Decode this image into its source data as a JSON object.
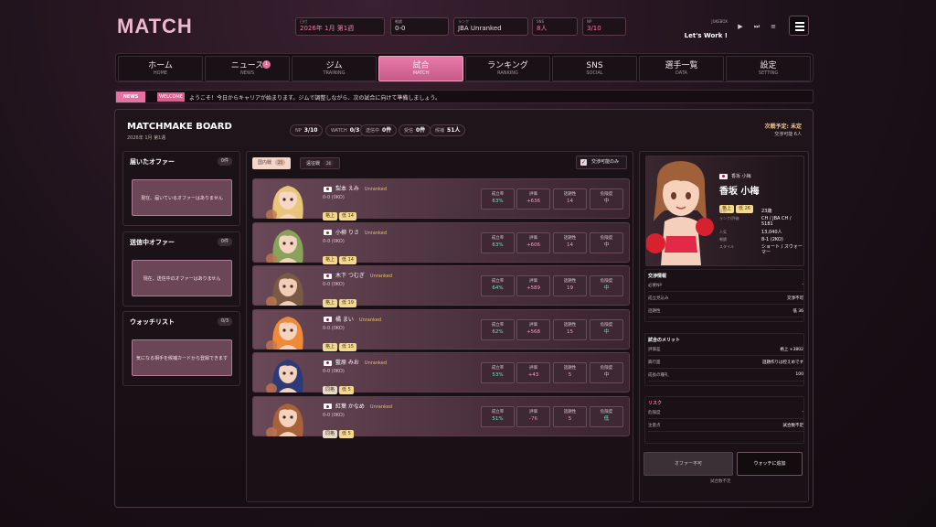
{
  "app": {
    "logo": "MATCH"
  },
  "stats": [
    {
      "label": "日付",
      "value": "2026年 1月 第1週",
      "pink": true
    },
    {
      "label": "戦績",
      "value": "0-0",
      "pink": false
    },
    {
      "label": "ランク",
      "value": "JBA Unranked",
      "pink": false
    },
    {
      "label": "SNS",
      "value": "8人",
      "pink": true
    },
    {
      "label": "NP",
      "value": "3/10",
      "pink": true
    }
  ],
  "jukebox": {
    "label": "JUKEBOX",
    "track": "Let's Work !"
  },
  "nav": [
    {
      "label": "ホーム",
      "sub": "HOME"
    },
    {
      "label": "ニュース",
      "sub": "NEWS",
      "badge": "1"
    },
    {
      "label": "ジム",
      "sub": "TRAINING"
    },
    {
      "label": "試合",
      "sub": "MATCH",
      "active": true
    },
    {
      "label": "ランキング",
      "sub": "RANKING"
    },
    {
      "label": "SNS",
      "sub": "SOCIAL"
    },
    {
      "label": "選手一覧",
      "sub": "DATA"
    },
    {
      "label": "設定",
      "sub": "SETTING"
    }
  ],
  "news": {
    "tag": "NEWS",
    "subtag": "WELCOME",
    "text": "ようこそ！今日からキャリアが始まります。ジムで調整しながら、次の試合に向けて準備しましょう。"
  },
  "board": {
    "title": "MATCHMAKE BOARD",
    "date": "2026年 1月 第1週",
    "chips": [
      {
        "label": "NP",
        "value": "3/10"
      },
      {
        "label": "WATCH",
        "value": "0/3"
      },
      {
        "label": "送信中",
        "value": "0件"
      },
      {
        "label": "受信",
        "value": "0件"
      },
      {
        "label": "候補",
        "value": "51人"
      }
    ],
    "next_match": "次戦予定: 未定",
    "negotiable": "交渉可能 6人"
  },
  "left": [
    {
      "title": "届いたオファー",
      "count": "0件",
      "empty": "現在、届いているオファーはありません"
    },
    {
      "title": "送信中オファー",
      "count": "0件",
      "empty": "現在、送信中のオファーはありません"
    },
    {
      "title": "ウォッチリスト",
      "count": "0/3",
      "empty": "気になる相手を候補カードから登録できます"
    }
  ],
  "filters": {
    "domestic": "国内戦",
    "domestic_count": "25",
    "overseas": "遠征戦",
    "overseas_count": "26",
    "only_negotiable": "交渉可能のみ"
  },
  "stat_labels": {
    "success": "成立率",
    "rating": "評価",
    "topic": "話題性",
    "danger": "危険度"
  },
  "candidates": [
    {
      "name": "梨本 えみ",
      "rank": "Unranked",
      "record": "0-0 (0KO)",
      "tag1": "格上",
      "tag2": "低 14",
      "success": "63%",
      "rating": "+636",
      "topic": "14",
      "danger": "中",
      "hair": "#e8c67a",
      "skin": "#f6d6c4"
    },
    {
      "name": "小柳 りさ",
      "rank": "Unranked",
      "record": "0-0 (0KO)",
      "tag1": "格上",
      "tag2": "低 14",
      "success": "63%",
      "rating": "+606",
      "topic": "14",
      "danger": "中",
      "hair": "#8aa35a",
      "skin": "#f4d4c0"
    },
    {
      "name": "木下 つむぎ",
      "rank": "Unranked",
      "record": "0-0 (0KO)",
      "tag1": "格上",
      "tag2": "低 19",
      "success": "64%",
      "rating": "+589",
      "topic": "19",
      "danger": "中",
      "hair": "#7a5a44",
      "skin": "#f2cdb6"
    },
    {
      "name": "橘 まい",
      "rank": "Unranked",
      "record": "0-0 (0KO)",
      "tag1": "格上",
      "tag2": "低 15",
      "success": "62%",
      "rating": "+568",
      "topic": "15",
      "danger": "中",
      "hair": "#f08a3a",
      "skin": "#f6d3bd"
    },
    {
      "name": "藍原 みお",
      "rank": "Unranked",
      "record": "0-0 (0KO)",
      "tag1": "同格",
      "tag2": "低 5",
      "success": "53%",
      "rating": "+43",
      "topic": "5",
      "danger": "中",
      "hair": "#2c3a78",
      "skin": "#f3d2c0"
    },
    {
      "name": "紅葉 かなめ",
      "rank": "Unranked",
      "record": "0-0 (0KO)",
      "tag1": "同格",
      "tag2": "低 5",
      "success": "51%",
      "rating": "-76",
      "topic": "5",
      "danger": "低",
      "hair": "#a8623a",
      "skin": "#f5d2bc"
    }
  ],
  "profile": {
    "kana": "香坂 小梅",
    "name": "香坂 小梅",
    "tag1": "格上",
    "tag2": "低 26",
    "fields": [
      {
        "k": "年齢",
        "v": "23歳"
      },
      {
        "k": "ランク/評価",
        "v": "CH / JBA CH / 5181"
      },
      {
        "k": "人気",
        "v": "13,040人"
      },
      {
        "k": "戦績",
        "v": "8-1 (2KO)"
      },
      {
        "k": "スタイル",
        "v": "ショート / スウォーマー"
      }
    ]
  },
  "negotiation": {
    "title": "交渉情報",
    "rows": [
      {
        "k": "必要NP",
        "v": "-"
      },
      {
        "k": "成立見込み",
        "v": "交渉不可"
      },
      {
        "k": "話題性",
        "v": "低 36"
      }
    ]
  },
  "merits": {
    "title": "試合のメリット",
    "rows": [
      {
        "k": "評価差",
        "v": "格上 +3802"
      },
      {
        "k": "興行面",
        "v": "話題作りは控えめです"
      },
      {
        "k": "成長の糧礼",
        "v": "100"
      }
    ]
  },
  "risk": {
    "title": "リスク",
    "rows": [
      {
        "k": "危険度",
        "v": "-"
      },
      {
        "k": "注意点",
        "v": "試合数不足"
      }
    ]
  },
  "actions": {
    "offer": "オファー不可",
    "watch": "ウォッチに追加",
    "note": "試合数不足"
  }
}
